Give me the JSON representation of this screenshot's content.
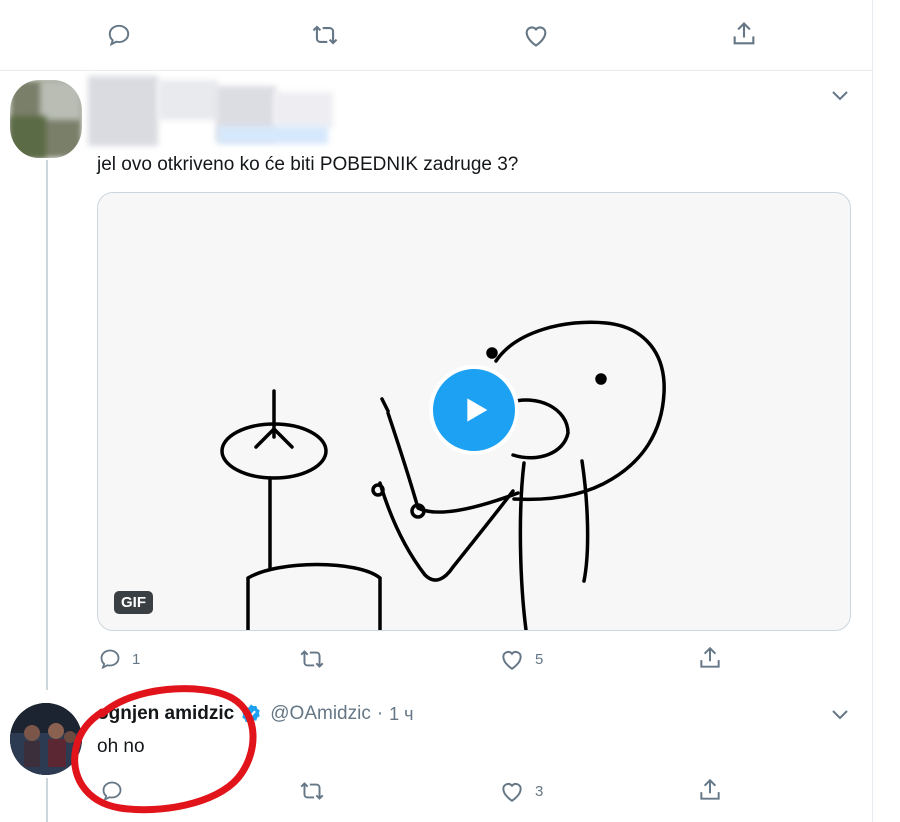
{
  "top_actions": {
    "icons": [
      "reply-icon",
      "retweet-icon",
      "like-icon",
      "share-icon"
    ]
  },
  "tweet1": {
    "author_display": "",
    "text": "jel ovo otkriveno ko će biti POBEDNIK zadruge 3?",
    "media": {
      "badge": "GIF",
      "play_icon": "play-icon"
    },
    "actions": {
      "reply_count": "1",
      "like_count": "5"
    }
  },
  "tweet2": {
    "name": "ognjen amidzic",
    "verified_icon": "verified-badge-icon",
    "handle": "@OAmidzic",
    "dot": "·",
    "time": "1 ч",
    "text": "oh no",
    "actions": {
      "reply_count": "",
      "like_count": "3"
    }
  },
  "colors": {
    "accent": "#1da1f2",
    "muted": "#657786",
    "border": "#e6ecf0",
    "annotation": "#e2141b"
  }
}
